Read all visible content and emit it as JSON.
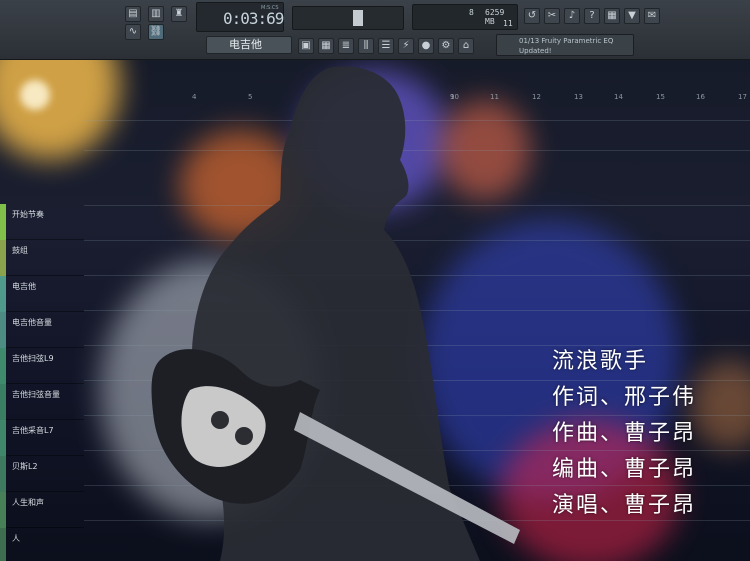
{
  "toolbar": {
    "time_display": "0:03:69",
    "time_unit": "M:S:CS",
    "memory": "6259 MB",
    "cpu_value": "8",
    "polyphony": "11",
    "pattern_name": "电吉他",
    "hint_line1": "01/13  Fruity Parametric EQ",
    "hint_line2": "Updated!",
    "icons": [
      "piano-roll-icon",
      "channel-rack-icon",
      "mixer-icon",
      "browser-icon",
      "plugin-icon",
      "record-icon"
    ]
  },
  "playlist": {
    "ruler_marks": [
      "4",
      "5",
      "9",
      "10",
      "11",
      "12",
      "13",
      "14",
      "15",
      "16",
      "17"
    ],
    "tracks": [
      {
        "label": "开始节奏",
        "color": "#7fbf4a"
      },
      {
        "label": "鼓组",
        "color": "#8aa24b"
      },
      {
        "label": "电吉他",
        "color": "#4f9a8a"
      },
      {
        "label": "电吉他音量",
        "color": "#4c8c82"
      },
      {
        "label": "吉他扫弦L9",
        "color": "#3f8a6d"
      },
      {
        "label": "吉他扫弦音量",
        "color": "#3a7f63"
      },
      {
        "label": "吉他采音L7",
        "color": "#40866a"
      },
      {
        "label": "贝斯L2",
        "color": "#3d7a5f"
      },
      {
        "label": "人生和声",
        "color": "#477f57"
      },
      {
        "label": "人",
        "color": "#3c6e4f"
      }
    ]
  },
  "credits": {
    "title": "流浪歌手",
    "lyricist": "作词、邢子伟",
    "composer": "作曲、曹子昂",
    "arranger": "编曲、曹子昂",
    "singer": "演唱、曹子昂"
  },
  "colors": {
    "toolbar_bg": "#2f353b",
    "accent_green": "#5fc878",
    "credit_text": "#ffffff"
  }
}
